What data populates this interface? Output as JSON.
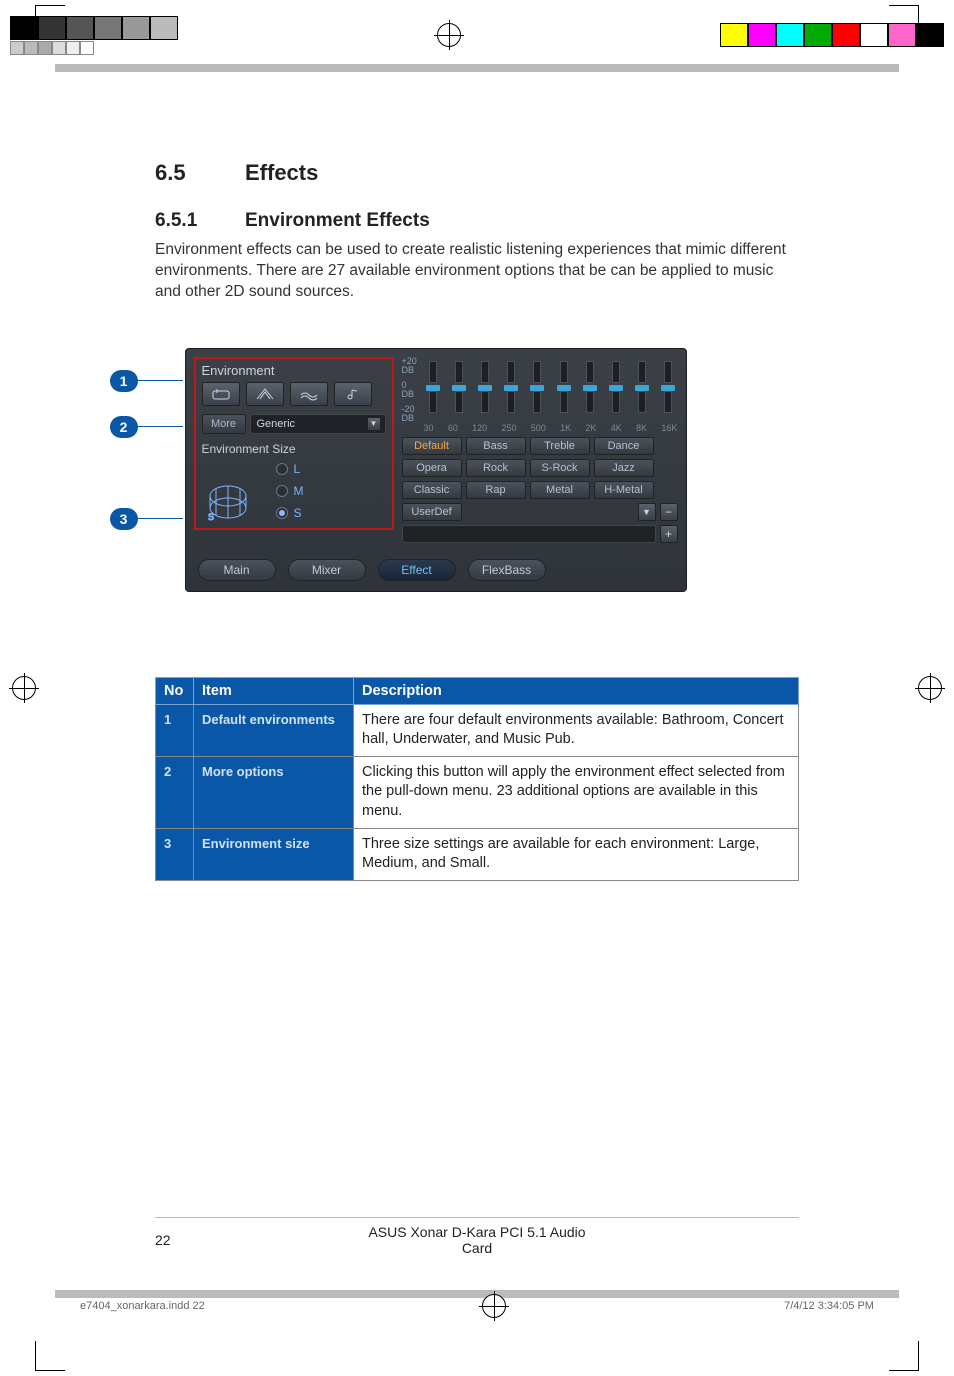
{
  "section": {
    "num": "6.5",
    "title": "Effects"
  },
  "subsection": {
    "num": "6.5.1",
    "title": "Environment Effects"
  },
  "paragraph": "Environment effects can be used to create realistic listening experiences that mimic different environments. There are 27 available environment options that be can be applied to music and other 2D sound sources.",
  "callouts": [
    "1",
    "2",
    "3"
  ],
  "ui": {
    "envLabel": "Environment",
    "moreLabel": "More",
    "dropdownValue": "Generic",
    "envSizeLabel": "Environment Size",
    "sizeOptions": [
      "L",
      "M",
      "S"
    ],
    "sizeSelected": "S",
    "dbLabels": {
      "top": "+20",
      "mid": "0",
      "low": "-20",
      "unit": "DB"
    },
    "freqs": [
      "30",
      "60",
      "120",
      "250",
      "500",
      "1K",
      "2K",
      "4K",
      "8K",
      "16K"
    ],
    "presets": [
      "Default",
      "Bass",
      "Treble",
      "Dance",
      "Opera",
      "Rock",
      "S-Rock",
      "Jazz",
      "Classic",
      "Rap",
      "Metal",
      "H-Metal",
      "UserDef"
    ],
    "presetActive": "Default",
    "tabs": [
      "Main",
      "Mixer",
      "Effect",
      "FlexBass"
    ],
    "tabActive": "Effect"
  },
  "table": {
    "headers": {
      "no": "No",
      "item": "Item",
      "desc": "Description"
    },
    "rows": [
      {
        "no": "1",
        "item": "Default environments",
        "desc": "There are four default environments available: Bathroom, Concert hall, Underwater, and Music Pub."
      },
      {
        "no": "2",
        "item": "More options",
        "desc": "Clicking this button will apply the environment effect selected from the pull-down menu. 23 additional options are available in this menu."
      },
      {
        "no": "3",
        "item": "Environment size",
        "desc": "Three size settings are available for each environment: Large, Medium, and Small."
      }
    ]
  },
  "footer": {
    "pageNum": "22",
    "title": "ASUS Xonar D-Kara PCI 5.1 Audio Card"
  },
  "indd": {
    "file": "e7404_xonarkara.indd   22",
    "date": "7/4/12   3:34:05 PM"
  }
}
